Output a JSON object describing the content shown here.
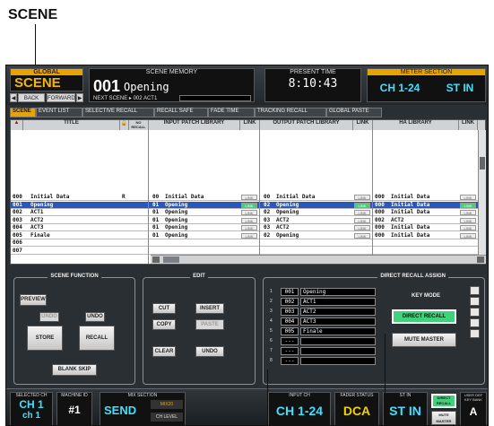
{
  "callout": {
    "title": "SCENE"
  },
  "header": {
    "scene_label_top": "GLOBAL",
    "scene_label": "SCENE",
    "nav_back": "BACK",
    "nav_forward": "FORWARD",
    "scene_memory_caption": "SCENE MEMORY",
    "scene_number": "001",
    "scene_name": "Opening",
    "next_caption": "NEXT SCENE",
    "next_scene": "002 ACT1",
    "present_time_caption": "PRESENT TIME",
    "present_time": "8:10:43",
    "meter_caption": "METER SECTION",
    "meter_a": "CH 1-24",
    "meter_b": "ST IN"
  },
  "tabs": [
    {
      "label": "SCENE",
      "active": true
    },
    {
      "label": "EVENT LIST"
    },
    {
      "label": "SELECTIVE RECALL"
    },
    {
      "label": "RECALL SAFE"
    },
    {
      "label": "FADE TIME"
    },
    {
      "label": "TRACKING RECALL"
    },
    {
      "label": "GLOBAL PASTE"
    }
  ],
  "table": {
    "headers": {
      "title": "TITLE",
      "no_recall": "NO RECALL",
      "input_patch": "INPUT PATCH LIBRARY",
      "link": "LINK",
      "output_patch": "OUTPUT PATCH LIBRARY",
      "ha_library": "HA LIBRARY"
    },
    "rows": [
      {
        "num": "000",
        "title": "Initial Data",
        "flag": "R",
        "in_no": "00",
        "in_name": "Initial Data",
        "out_no": "00",
        "out_name": "Initial Data",
        "ha_no": "000",
        "ha_name": "Initial Data",
        "selected": false
      },
      {
        "num": "001",
        "title": "Opening",
        "flag": "",
        "in_no": "01",
        "in_name": "Opening",
        "out_no": "02",
        "out_name": "Opening",
        "ha_no": "000",
        "ha_name": "Initial Data",
        "selected": true
      },
      {
        "num": "002",
        "title": "ACT1",
        "flag": "",
        "in_no": "01",
        "in_name": "Opening",
        "out_no": "02",
        "out_name": "Opening",
        "ha_no": "000",
        "ha_name": "Initial Data",
        "selected": false
      },
      {
        "num": "003",
        "title": "ACT2",
        "flag": "",
        "in_no": "01",
        "in_name": "Opening",
        "out_no": "03",
        "out_name": "ACT2",
        "ha_no": "002",
        "ha_name": "ACT2",
        "selected": false
      },
      {
        "num": "004",
        "title": "ACT3",
        "flag": "",
        "in_no": "01",
        "in_name": "Opening",
        "out_no": "03",
        "out_name": "ACT2",
        "ha_no": "000",
        "ha_name": "Initial Data",
        "selected": false
      },
      {
        "num": "005",
        "title": "Finale",
        "flag": "",
        "in_no": "01",
        "in_name": "Opening",
        "out_no": "02",
        "out_name": "Opening",
        "ha_no": "000",
        "ha_name": "Initial Data",
        "selected": false
      },
      {
        "num": "006",
        "title": "",
        "flag": "",
        "in_no": "",
        "in_name": "",
        "out_no": "",
        "out_name": "",
        "ha_no": "",
        "ha_name": "",
        "selected": false
      },
      {
        "num": "007",
        "title": "",
        "flag": "",
        "in_no": "",
        "in_name": "",
        "out_no": "",
        "out_name": "",
        "ha_no": "",
        "ha_name": "",
        "selected": false
      }
    ],
    "link_label": "LINK"
  },
  "scene_function": {
    "title": "SCENE FUNCTION",
    "preview": "PREVIEW",
    "undo_left": "UNDO",
    "undo_right": "UNDO",
    "store": "STORE",
    "recall": "RECALL",
    "blank_skip": "BLANK SKIP"
  },
  "edit": {
    "title": "EDIT",
    "cut": "CUT",
    "insert": "INSERT",
    "copy": "COPY",
    "paste": "PASTE",
    "clear": "CLEAR",
    "undo": "UNDO"
  },
  "direct_recall": {
    "title": "DIRECT RECALL ASSIGN",
    "items": [
      {
        "idx": "1",
        "num": "001",
        "name": "Opening"
      },
      {
        "idx": "2",
        "num": "002",
        "name": "ACT1"
      },
      {
        "idx": "3",
        "num": "003",
        "name": "ACT2"
      },
      {
        "idx": "4",
        "num": "004",
        "name": "ACT3"
      },
      {
        "idx": "5",
        "num": "005",
        "name": "Finale"
      },
      {
        "idx": "6",
        "num": "---",
        "name": ""
      },
      {
        "idx": "7",
        "num": "---",
        "name": ""
      },
      {
        "idx": "8",
        "num": "---",
        "name": ""
      }
    ],
    "key_mode": "KEY MODE",
    "direct_recall_btn": "DIRECT RECALL",
    "mute_master_btn": "MUTE MASTER"
  },
  "footer": {
    "selected_ch_caption": "SELECTED CH",
    "selected_ch": "CH 1",
    "selected_ch_name": "ch 1",
    "machine_caption": "MACHINE ID",
    "machine_id": "#1",
    "mix_caption": "MIX SECTION",
    "mix_value": "SEND",
    "mix_bus": "MIX20",
    "ch_level": "CH LEVEL",
    "input_ch_caption": "INPUT CH",
    "input_ch": "CH 1-24",
    "fader_caption": "FADER STATUS",
    "fader_value": "DCA",
    "st_caption": "ST IN",
    "st_value": "ST IN",
    "direct_recall": "DIRECT RECALL",
    "mute_master": "MUTE MASTER",
    "user_key_caption": "USER DEF KEY BANK",
    "user_key": "A"
  }
}
